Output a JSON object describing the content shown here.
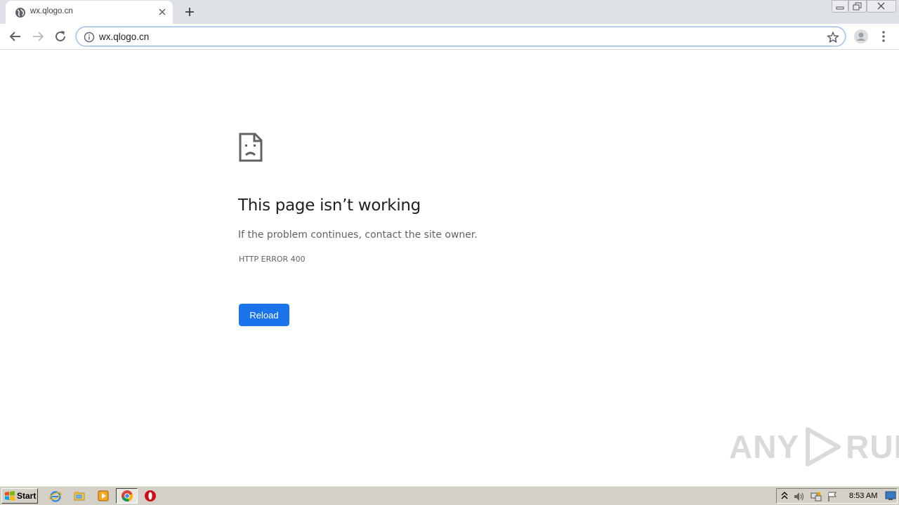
{
  "browser": {
    "tab": {
      "title": "wx.qlogo.cn"
    },
    "address_bar": {
      "url": "wx.qlogo.cn"
    }
  },
  "error_page": {
    "title": "This page isn’t working",
    "message": "If the problem continues, contact the site owner.",
    "error_code": "HTTP ERROR 400",
    "reload_label": "Reload"
  },
  "watermark": {
    "left_text": "ANY",
    "right_text": "RUN"
  },
  "taskbar": {
    "start_label": "Start",
    "clock": "8:53 AM"
  },
  "colors": {
    "accent": "#1a73e8",
    "tabstrip": "#dee1e6",
    "taskbar": "#d4d0c8"
  },
  "icons": [
    "globe-icon",
    "close-icon",
    "plus-icon",
    "back-arrow-icon",
    "forward-arrow-icon",
    "reload-icon",
    "info-icon",
    "star-icon",
    "profile-icon",
    "menu-dots-icon",
    "sad-page-icon",
    "ie-icon",
    "folder-icon",
    "media-player-icon",
    "chrome-icon",
    "opera-icon"
  ]
}
